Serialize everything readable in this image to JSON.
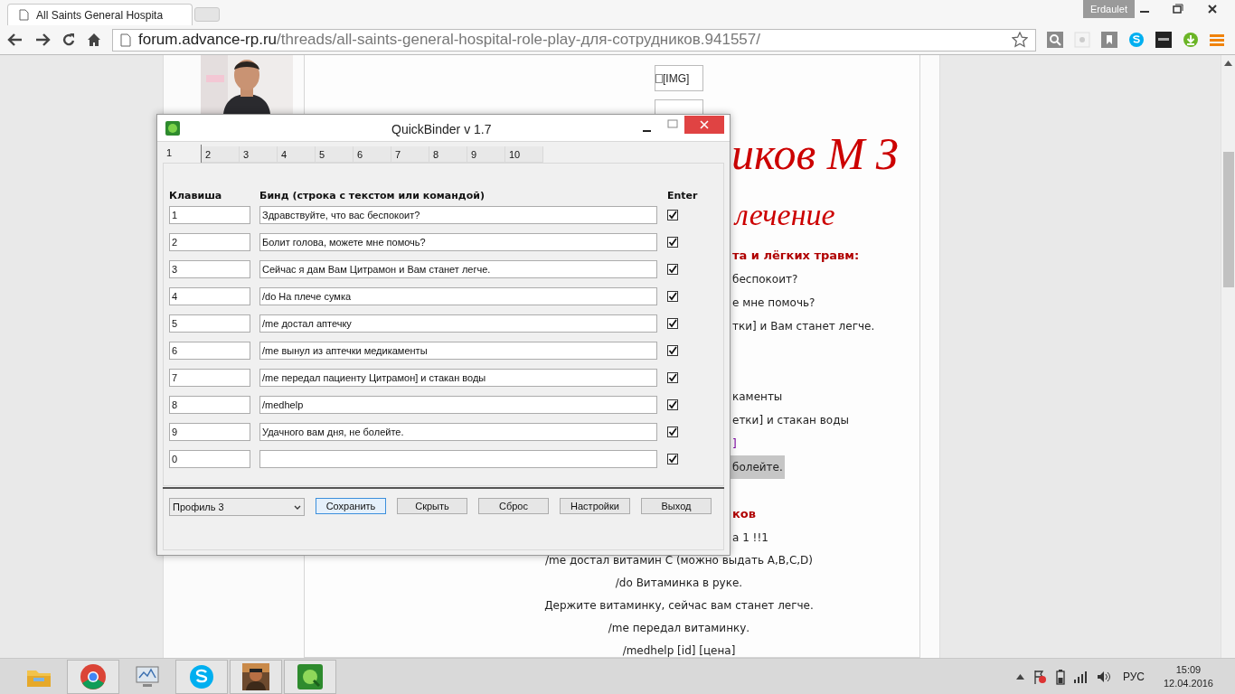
{
  "browser": {
    "tab_title": "All Saints General Hospita",
    "user": "Erdaulet",
    "url_host": "forum.advance-rp.ru",
    "url_path": "/threads/all-saints-general-hospital-role-play-для-сотрудников.941557/"
  },
  "forum": {
    "images": [
      {
        "kind": "labeled",
        "label": "[IMG]"
      },
      {
        "kind": "cut"
      }
    ],
    "heading": "иков М З",
    "subheading": "лечение",
    "groups": [
      [
        {
          "kind": "header",
          "text": "та и лёгких травм:"
        },
        {
          "kind": "text",
          "text": "беспокоит?"
        },
        {
          "kind": "text",
          "text": "е мне помочь?"
        },
        {
          "kind": "text",
          "text": "тки] и Вам станет легче."
        }
      ],
      [
        {
          "kind": "text",
          "text": "каменты"
        },
        {
          "kind": "text",
          "text": "етки] и стакан воды"
        },
        {
          "kind": "link",
          "text": "]"
        },
        {
          "kind": "highlight",
          "text": "болейте."
        }
      ],
      [
        {
          "kind": "header",
          "text": "ков"
        },
        {
          "kind": "text",
          "text": "а 1 !!1"
        },
        {
          "kind": "centered",
          "text": "/me достал витамин С (можно выдать A,B,C,D)"
        },
        {
          "kind": "centered",
          "text": "/do Витаминка в руке."
        },
        {
          "kind": "centered",
          "text": "Держите витаминку, сейчас вам станет легче."
        },
        {
          "kind": "centered",
          "text": "/me передал витаминку."
        },
        {
          "kind": "centered",
          "text": "/medhelp [id] [цена]"
        }
      ]
    ]
  },
  "dialog": {
    "title": "QuickBinder v 1.7",
    "tabs": [
      {
        "label": "1",
        "selected": true
      },
      {
        "label": "2",
        "selected": false
      },
      {
        "label": "3",
        "selected": false
      },
      {
        "label": "4",
        "selected": false
      },
      {
        "label": "5",
        "selected": false
      },
      {
        "label": "6",
        "selected": false
      },
      {
        "label": "7",
        "selected": false
      },
      {
        "label": "8",
        "selected": false
      },
      {
        "label": "9",
        "selected": false
      },
      {
        "label": "10",
        "selected": false
      }
    ],
    "columns": [
      "Клавиша",
      "Бинд (строка с текстом или командой)",
      "Enter"
    ],
    "rows": [
      {
        "key": "1",
        "bind": "Здравствуйте, что вас беспокоит?",
        "enter": true
      },
      {
        "key": "2",
        "bind": "Болит голова, можете мне помочь?",
        "enter": true
      },
      {
        "key": "3",
        "bind": "Сейчас я дам Вам Цитрамон и Вам станет легче.",
        "enter": true
      },
      {
        "key": "4",
        "bind": "/do На плече сумка",
        "enter": true
      },
      {
        "key": "5",
        "bind": "/me достал аптечку",
        "enter": true
      },
      {
        "key": "6",
        "bind": "/me вынул из аптечки медикаменты",
        "enter": true
      },
      {
        "key": "7",
        "bind": "/me передал пациенту Цитрамон] и стакан воды",
        "enter": true
      },
      {
        "key": "8",
        "bind": "/medhelp",
        "enter": true
      },
      {
        "key": "9",
        "bind": "Удачного вам дня, не болейте.",
        "enter": true
      },
      {
        "key": "0",
        "bind": "",
        "enter": true
      }
    ],
    "profile": "Профиль 3",
    "buttons": [
      {
        "label": "Сохранить",
        "selected": true
      },
      {
        "label": "Скрыть",
        "selected": false
      },
      {
        "label": "Сброс",
        "selected": false
      },
      {
        "label": "Настройки",
        "selected": false
      },
      {
        "label": "Выход",
        "selected": false
      }
    ]
  },
  "taskbar": {
    "language": "РУС",
    "time": "15:09",
    "date": "12.04.2016"
  }
}
